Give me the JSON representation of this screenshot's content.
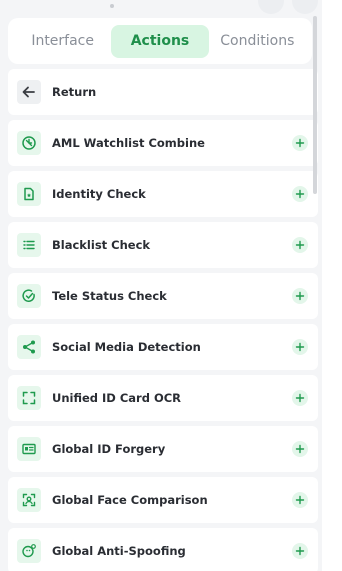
{
  "tabs": [
    {
      "label": "Interface",
      "active": false
    },
    {
      "label": "Actions",
      "active": true
    },
    {
      "label": "Conditions",
      "active": false
    }
  ],
  "return_label": "Return",
  "actions": [
    {
      "label": "AML Watchlist Combine",
      "icon": "aml-watchlist-icon"
    },
    {
      "label": "Identity Check",
      "icon": "identity-check-icon"
    },
    {
      "label": "Blacklist Check",
      "icon": "list-icon"
    },
    {
      "label": "Tele Status Check",
      "icon": "check-circle-icon"
    },
    {
      "label": "Social Media Detection",
      "icon": "share-icon"
    },
    {
      "label": "Unified ID Card OCR",
      "icon": "scan-frame-icon"
    },
    {
      "label": "Global ID Forgery",
      "icon": "id-card-icon"
    },
    {
      "label": "Global Face Comparison",
      "icon": "face-scan-icon"
    },
    {
      "label": "Global Anti-Spoofing",
      "icon": "face-settings-icon"
    }
  ],
  "colors": {
    "accent": "#1f9a4e",
    "accent_light": "#d8f5e2",
    "text": "#2a2d33",
    "muted": "#8a8f98"
  }
}
